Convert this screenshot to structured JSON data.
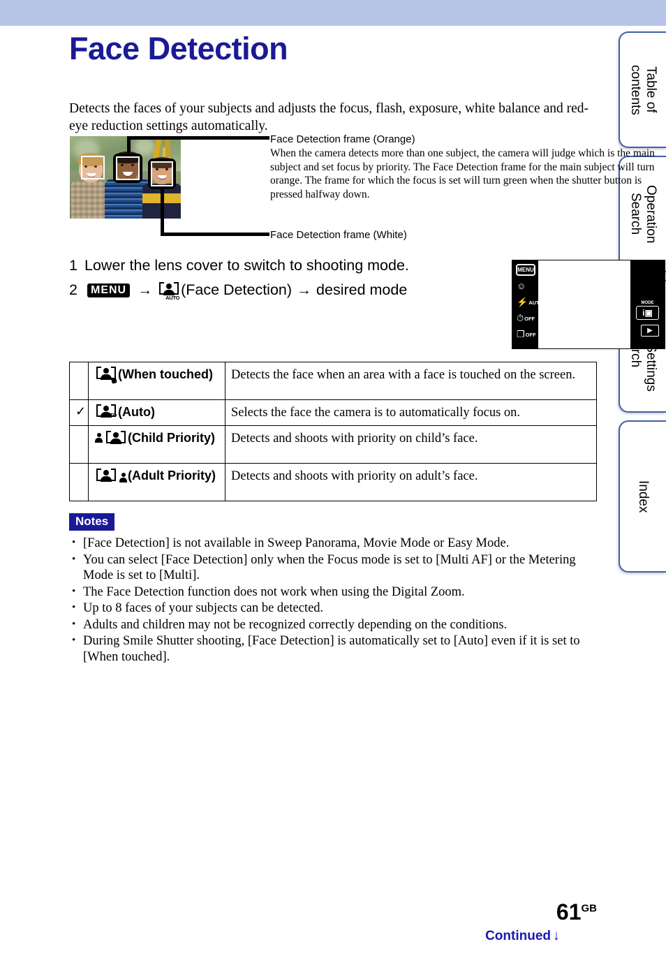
{
  "colors": {
    "top_band": "#b7c5e9",
    "title": "#1a1a96",
    "notes_badge_bg": "#1a1a96",
    "tab_border": "#3f5fa8",
    "continued_link": "#1a1ab4"
  },
  "sidebar": {
    "tabs": [
      {
        "label": "Table of\ncontents"
      },
      {
        "label": "Operation\nSearch"
      },
      {
        "label": "MENU/Settings\nSearch"
      },
      {
        "label": "Index"
      }
    ]
  },
  "page": {
    "title": "Face Detection",
    "intro": "Detects the faces of your subjects and adjusts the focus, flash, exposure, white balance and red-eye reduction settings automatically."
  },
  "figure": {
    "callout_orange_title": "Face Detection frame (Orange)",
    "callout_orange_body": "When the camera detects more than one subject, the camera will judge which is the main subject and set focus by priority. The Face Detection frame for the main subject will turn orange. The frame for which the focus is set will turn green when the shutter button is pressed halfway down.",
    "callout_white_title": "Face Detection frame (White)"
  },
  "steps": [
    {
      "num": "1",
      "text": "Lower the lens cover to switch to shooting mode."
    },
    {
      "num": "2",
      "menu_chip": "MENU",
      "arrow1": "→",
      "icon_label": "(Face Detection)",
      "arrow2": "→",
      "tail": "desired mode"
    }
  ],
  "lcd": {
    "menu_button": "MENU",
    "smile_icon": "☺",
    "flash_icon": "⚡",
    "flash_value": "AUTO",
    "timer_icon": "⏱",
    "timer_value": "OFF",
    "burst_icon": "❐",
    "burst_value": "OFF",
    "mode_label": "MODE",
    "mode_icon": "i▣",
    "play_icon": "▶"
  },
  "table": {
    "rows": [
      {
        "check": "",
        "icon": "face-touch-icon",
        "name": "(When touched)",
        "desc": "Detects the face when an area with a face is touched on the screen."
      },
      {
        "check": "✓",
        "icon": "face-auto-icon",
        "name": "(Auto)",
        "desc": "Selects the face the camera is to automatically focus on."
      },
      {
        "check": "",
        "icon": "face-child-priority-icon",
        "name": "(Child Priority)",
        "desc": "Detects and shoots with priority on child’s face."
      },
      {
        "check": "",
        "icon": "face-adult-priority-icon",
        "name": "(Adult Priority)",
        "desc": "Detects and shoots with priority on adult’s face."
      }
    ]
  },
  "notes": {
    "badge": "Notes",
    "items": [
      "[Face Detection] is not available in Sweep Panorama, Movie Mode or Easy Mode.",
      "You can select [Face Detection] only when the Focus mode is set to [Multi AF] or the Metering Mode is set to [Multi].",
      "The Face Detection function does not work when using the Digital Zoom.",
      "Up to 8 faces of your subjects can be detected.",
      "Adults and children may not be recognized correctly depending on the conditions.",
      "During Smile Shutter shooting, [Face Detection] is automatically set to [Auto] even if it is set to [When touched]."
    ]
  },
  "footer": {
    "page_number": "61",
    "page_suffix": "GB",
    "continued": "Continued",
    "continued_arrow": "↓"
  }
}
